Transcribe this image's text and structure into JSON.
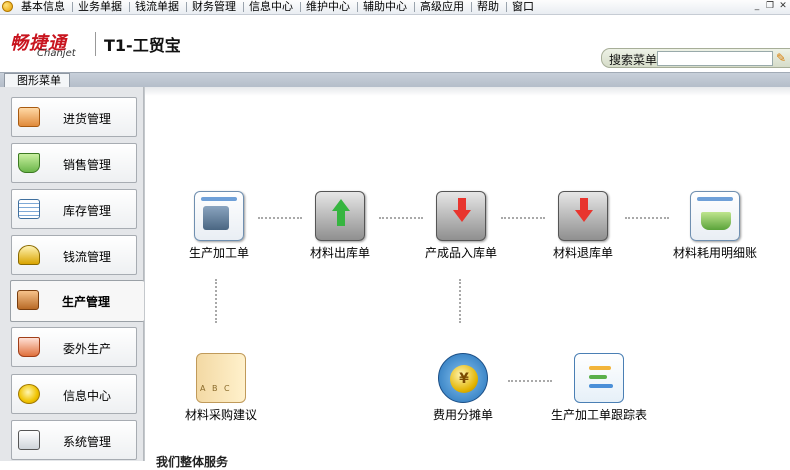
{
  "menubar": {
    "items": [
      "基本信息",
      "业务单据",
      "钱流单据",
      "财务管理",
      "信息中心",
      "维护中心",
      "辅助中心",
      "高级应用",
      "帮助",
      "窗口"
    ],
    "window_controls": [
      "_",
      "❐",
      "✕"
    ]
  },
  "header": {
    "brand_cn": "畅捷通",
    "brand_en": "Chanjet",
    "product": "T1-工贸宝",
    "search_label": "搜索菜单",
    "search_value": ""
  },
  "tabs": [
    "图形菜单"
  ],
  "sidebar": {
    "items": [
      {
        "label": "进货管理",
        "icon": "purchase-icon"
      },
      {
        "label": "销售管理",
        "icon": "sales-basket-icon"
      },
      {
        "label": "库存管理",
        "icon": "inventory-icon"
      },
      {
        "label": "钱流管理",
        "icon": "cashflow-icon"
      },
      {
        "label": "生产管理",
        "icon": "production-icon",
        "active": true
      },
      {
        "label": "委外生产",
        "icon": "outsource-icon"
      },
      {
        "label": "信息中心",
        "icon": "info-bulb-icon"
      },
      {
        "label": "系统管理",
        "icon": "system-settings-icon"
      }
    ]
  },
  "flow": {
    "nodes": [
      {
        "label": "生产加工单",
        "icon": "production-order-icon"
      },
      {
        "label": "材料出库单",
        "icon": "material-outbound-icon"
      },
      {
        "label": "产成品入库单",
        "icon": "finished-goods-inbound-icon"
      },
      {
        "label": "材料退库单",
        "icon": "material-return-icon"
      },
      {
        "label": "材料耗用明细账",
        "icon": "material-consumption-icon"
      },
      {
        "label": "材料采购建议",
        "icon": "purchase-suggestion-icon"
      },
      {
        "label": "费用分摊单",
        "icon": "cost-allocation-icon"
      },
      {
        "label": "生产加工单跟踪表",
        "icon": "production-tracking-icon"
      }
    ]
  },
  "footer_text": "我们整体服务"
}
